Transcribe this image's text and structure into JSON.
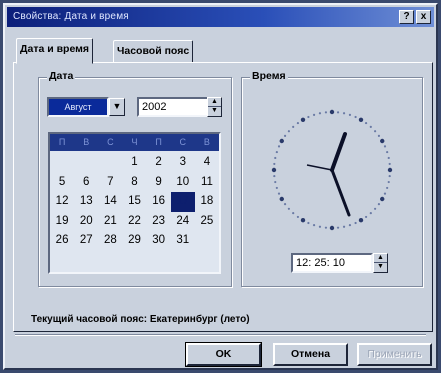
{
  "window": {
    "title": "Свойства: Дата и время"
  },
  "titlebar_buttons": {
    "help": "?",
    "close": "x"
  },
  "tabs": [
    {
      "label": "Дата и время",
      "active": true
    },
    {
      "label": "Часовой пояс",
      "active": false
    }
  ],
  "date_group": {
    "label": "Дата",
    "month": "Август",
    "year": "2002",
    "weekday_headers": [
      "П",
      "В",
      "С",
      "Ч",
      "П",
      "С",
      "В"
    ],
    "days": [
      "",
      "",
      "",
      "1",
      "2",
      "3",
      "4",
      "5",
      "6",
      "7",
      "8",
      "9",
      "10",
      "11",
      "12",
      "13",
      "14",
      "15",
      "16",
      "17",
      "18",
      "19",
      "20",
      "21",
      "22",
      "23",
      "24",
      "25",
      "26",
      "27",
      "28",
      "29",
      "30",
      "31",
      ""
    ],
    "selected_day": "17"
  },
  "time_group": {
    "label": "Время",
    "time": "12: 25: 10"
  },
  "timezone_text": "Текущий часовой пояс: Екатеринбург (лето)",
  "buttons": {
    "ok": "OK",
    "cancel": "Отмена",
    "apply": "Применить"
  },
  "colors": {
    "title_start": "#0c1f7a",
    "title_end": "#6f8fd6",
    "dialog_face": "#c9d1dd",
    "selection": "#0d1f6e"
  }
}
